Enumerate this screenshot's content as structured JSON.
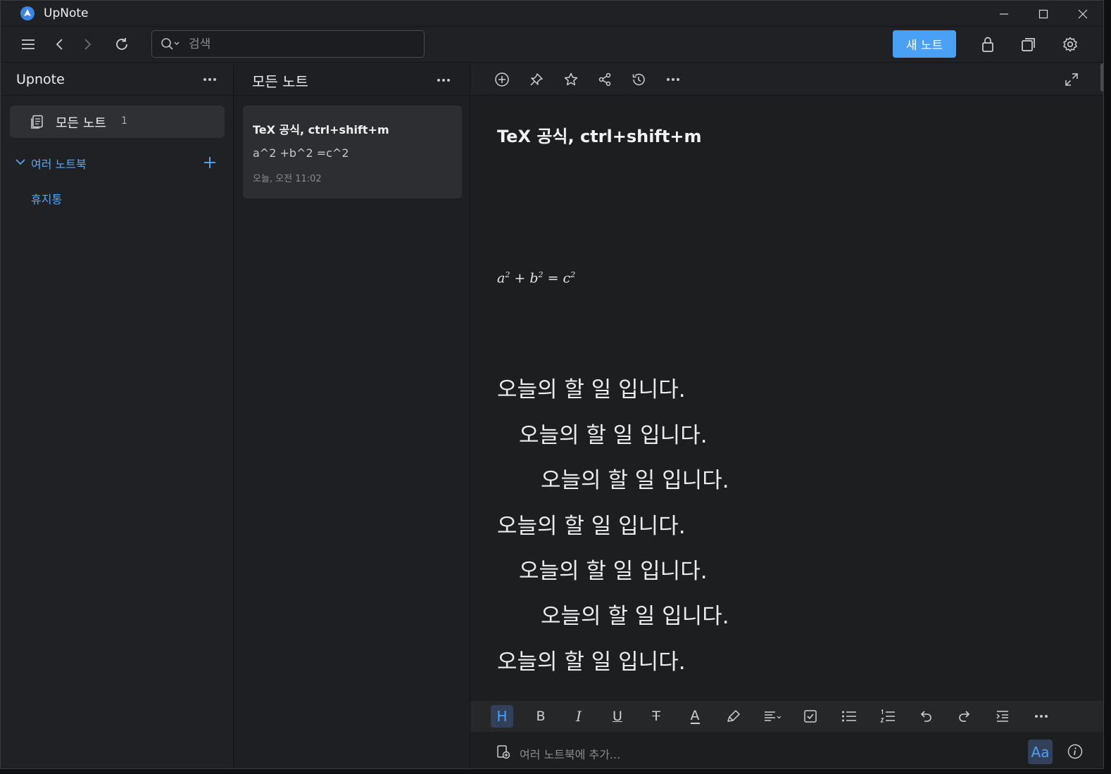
{
  "app": {
    "title": "UpNote"
  },
  "toolbar": {
    "search_placeholder": "검색",
    "new_note_label": "새 노트"
  },
  "sidebar": {
    "title": "Upnote",
    "all_notes_label": "모든 노트",
    "all_notes_count": "1",
    "notebooks_label": "여러 노트북",
    "trash_label": "휴지통"
  },
  "notelist": {
    "title": "모든 노트",
    "notes": [
      {
        "title": "TeX 공식, ctrl+shift+m",
        "preview": "a^2 +b^2 =c^2",
        "date": "오늘, 오전 11:02"
      }
    ]
  },
  "editor": {
    "title": "TeX 공식, ctrl+shift+m",
    "formula": {
      "a": "a",
      "b": "b",
      "c": "c",
      "exp": "2",
      "plus": "+",
      "eq": "="
    },
    "lines": [
      {
        "text": "오늘의 할 일 입니다.",
        "indent": 0
      },
      {
        "text": "오늘의 할 일 입니다.",
        "indent": 1
      },
      {
        "text": "오늘의 할 일 입니다.",
        "indent": 2
      },
      {
        "text": "오늘의 할 일 입니다.",
        "indent": 0
      },
      {
        "text": "오늘의 할 일 입니다.",
        "indent": 1
      },
      {
        "text": "오늘의 할 일 입니다.",
        "indent": 2
      },
      {
        "text": "오늘의 할 일 입니다.",
        "indent": 0
      }
    ],
    "format_bar": {
      "heading": "H",
      "bold": "B",
      "italic": "I",
      "underline": "U",
      "strike": "T",
      "text_color": "A"
    },
    "footer": {
      "add_to_notebook_placeholder": "여러 노트북에 추가...",
      "font_button": "Aa"
    }
  },
  "colors": {
    "accent": "#4aa0f5",
    "background": "#202124",
    "editor_bg": "#1d1e20",
    "card_bg": "#2d2e32"
  }
}
